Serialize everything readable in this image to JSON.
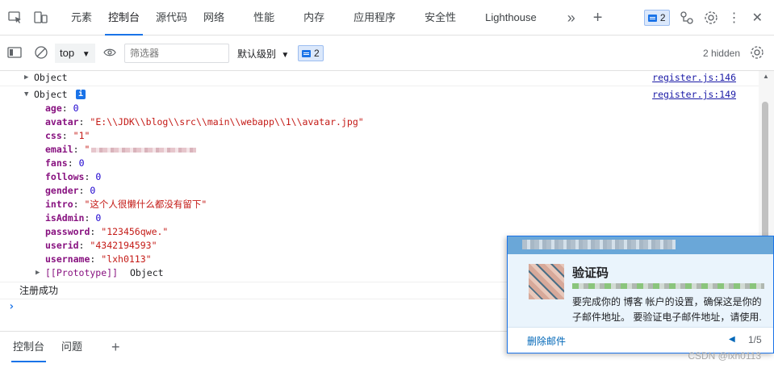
{
  "tabbar": {
    "tabs": [
      "元素",
      "控制台",
      "源代码",
      "网络",
      "性能",
      "内存",
      "应用程序",
      "安全性",
      "Lighthouse"
    ],
    "active_tab": "控制台",
    "more": "»",
    "add": "+",
    "issues_badge": "2",
    "more_options": "⋮",
    "close": "✕"
  },
  "toolbar": {
    "context": "top",
    "filter_placeholder": "筛选器",
    "levels": "默认级别",
    "issues_count": "2",
    "hidden": "2 hidden"
  },
  "console": {
    "collapsed_object": "Object",
    "link1": "register.js:146",
    "expanded_object": "Object",
    "link2": "register.js:149",
    "info_badge": "i",
    "props": [
      {
        "key": "age",
        "value": "0",
        "type": "num"
      },
      {
        "key": "avatar",
        "value": "\"E:\\\\JDK\\\\blog\\\\src\\\\main\\\\webapp\\\\1\\\\avatar.jpg\"",
        "type": "str"
      },
      {
        "key": "css",
        "value": "\"1\"",
        "type": "str"
      },
      {
        "key": "email",
        "value": "\"",
        "type": "str-blur"
      },
      {
        "key": "fans",
        "value": "0",
        "type": "num"
      },
      {
        "key": "follows",
        "value": "0",
        "type": "num"
      },
      {
        "key": "gender",
        "value": "0",
        "type": "num"
      },
      {
        "key": "intro",
        "value": "\"这个人很懒什么都没有留下\"",
        "type": "str"
      },
      {
        "key": "isAdmin",
        "value": "0",
        "type": "num"
      },
      {
        "key": "password",
        "value": "\"123456qwe.\"",
        "type": "str"
      },
      {
        "key": "userid",
        "value": "\"4342194593\"",
        "type": "str"
      },
      {
        "key": "username",
        "value": "\"lxh0113\"",
        "type": "str"
      }
    ],
    "prototype_key": "[[Prototype]]",
    "prototype_value": "Object",
    "log_message": "注册成功",
    "prompt": "›"
  },
  "drawer": {
    "tabs": [
      "控制台",
      "问题"
    ],
    "add": "+"
  },
  "notification": {
    "title": "验证码",
    "body_line1": "要完成你的 博客 帐户的设置，确保这是你的",
    "body_line2": "子邮件地址。 要验证电子邮件地址，请使用.",
    "action": "删除邮件",
    "pager": "1/5",
    "prev": "◀"
  },
  "watermark": "CSDN @lxh0113"
}
